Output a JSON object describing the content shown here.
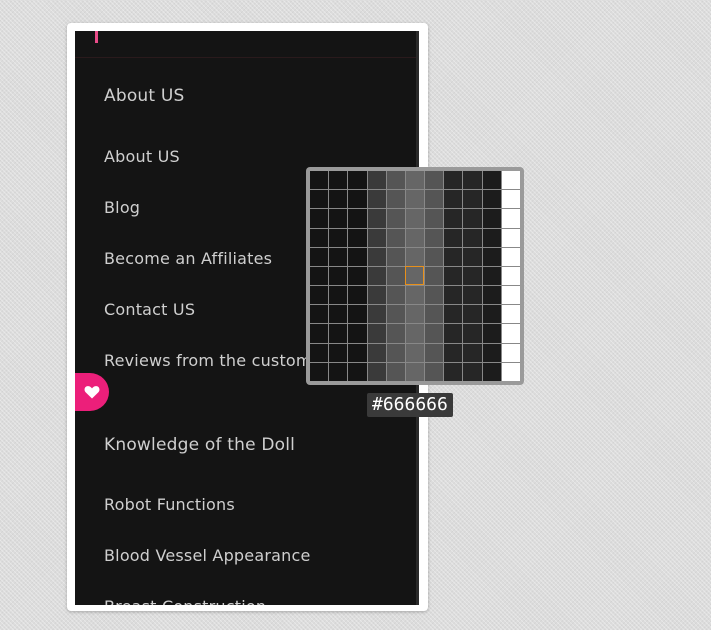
{
  "menu": {
    "section_title": "About US",
    "items": [
      {
        "label": "About US"
      },
      {
        "label": "Blog"
      },
      {
        "label": "Become an Affiliates"
      },
      {
        "label": "Contact US"
      },
      {
        "label": "Reviews from the customers"
      }
    ],
    "section2_title": "Knowledge of the Doll",
    "items2": [
      {
        "label": "Robot Functions"
      },
      {
        "label": "Blood Vessel Appearance"
      },
      {
        "label": "Breast Construction"
      }
    ]
  },
  "colors": {
    "panel_bg": "#141414",
    "accent_pink": "#ec1f7a",
    "sampled": "#666666",
    "magnifier_cursor": "#e8901a"
  },
  "heart_button": {
    "icon": "heart-icon"
  },
  "color_picker": {
    "hex_value": "#666666",
    "column_colors": [
      "#141414",
      "#141414",
      "#141414",
      "#3a3a3a",
      "#555555",
      "#666666",
      "#555555",
      "#262626",
      "#262626",
      "#1c1c1c",
      "#ffffff"
    ]
  }
}
